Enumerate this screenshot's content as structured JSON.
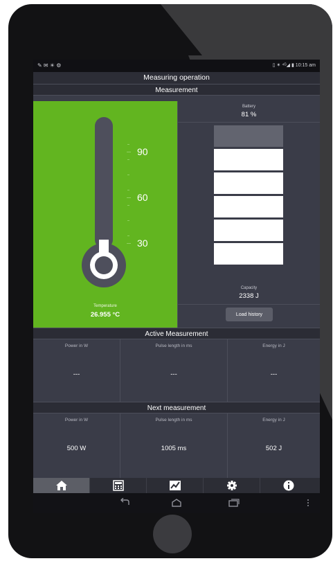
{
  "status_bar": {
    "left_icons": "✎ ✉ ☀ ⚙",
    "right_text": "▯ ✶ ⁴ᴳ◢ ▮ 10:15 am"
  },
  "title": "Measuring operation",
  "measurement": {
    "header": "Measurement",
    "thermometer": {
      "ticks": [
        "90",
        "60",
        "30"
      ],
      "temperature_label": "Temperature",
      "temperature_value": "26.955 °C",
      "fill_fraction": 0.05
    },
    "battery": {
      "label": "Battery",
      "value": "81 %",
      "capacity_label": "Capacity",
      "capacity_value": "2338 J",
      "segments_total": 6,
      "segments_filled": 5,
      "load_history_label": "Load history"
    }
  },
  "active_measurement": {
    "header": "Active Measurement",
    "columns": [
      {
        "label": "Power in W",
        "value": "---"
      },
      {
        "label": "Pulse length in ms",
        "value": "---"
      },
      {
        "label": "Energy in J",
        "value": "---"
      }
    ]
  },
  "next_measurement": {
    "header": "Next measurement",
    "columns": [
      {
        "label": "Power in W",
        "value": "500 W"
      },
      {
        "label": "Pulse length in ms",
        "value": "1005 ms"
      },
      {
        "label": "Energy in J",
        "value": "502 J"
      }
    ]
  },
  "tabs": [
    {
      "icon": "home-icon",
      "active": true
    },
    {
      "icon": "calculator-icon",
      "active": false
    },
    {
      "icon": "chart-icon",
      "active": false
    },
    {
      "icon": "gear-icon",
      "active": false
    },
    {
      "icon": "info-icon",
      "active": false
    }
  ],
  "system_nav": [
    "back-icon",
    "home-outline-icon",
    "recent-apps-icon",
    "overflow-menu-icon"
  ],
  "colors": {
    "accent_green": "#62b520",
    "panel_bg": "#3a3c48",
    "header_bg": "#2b2c35",
    "device_bezel": "#121214"
  }
}
